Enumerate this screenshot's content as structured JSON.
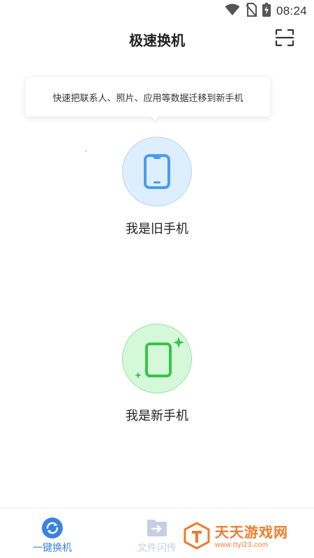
{
  "status_bar": {
    "time": "08:24",
    "icons": [
      "wifi-icon",
      "no-sim-icon",
      "battery-charging-icon"
    ]
  },
  "header": {
    "title": "极速换机",
    "scan_icon": "scan-icon"
  },
  "tip": {
    "text": "快速把联系人、照片、应用等数据迁移到新手机"
  },
  "roles": {
    "old_phone": {
      "label": "我是旧手机",
      "icon": "phone-icon",
      "color": "#4a9bf0"
    },
    "new_phone": {
      "label": "我是新手机",
      "icon": "new-phone-sparkle-icon",
      "color": "#36c44a"
    }
  },
  "bottom_nav": {
    "items": [
      {
        "label": "一键换机",
        "icon": "sync-icon",
        "active": true
      },
      {
        "label": "文件闪传",
        "icon": "file-transfer-icon",
        "active": false
      }
    ],
    "active_color": "#3b82e0",
    "inactive_color": "#c4cfe0"
  },
  "watermark": {
    "title": "天天游戏网",
    "url": "www.ttyl23.com",
    "color": "#ef7b2c"
  }
}
